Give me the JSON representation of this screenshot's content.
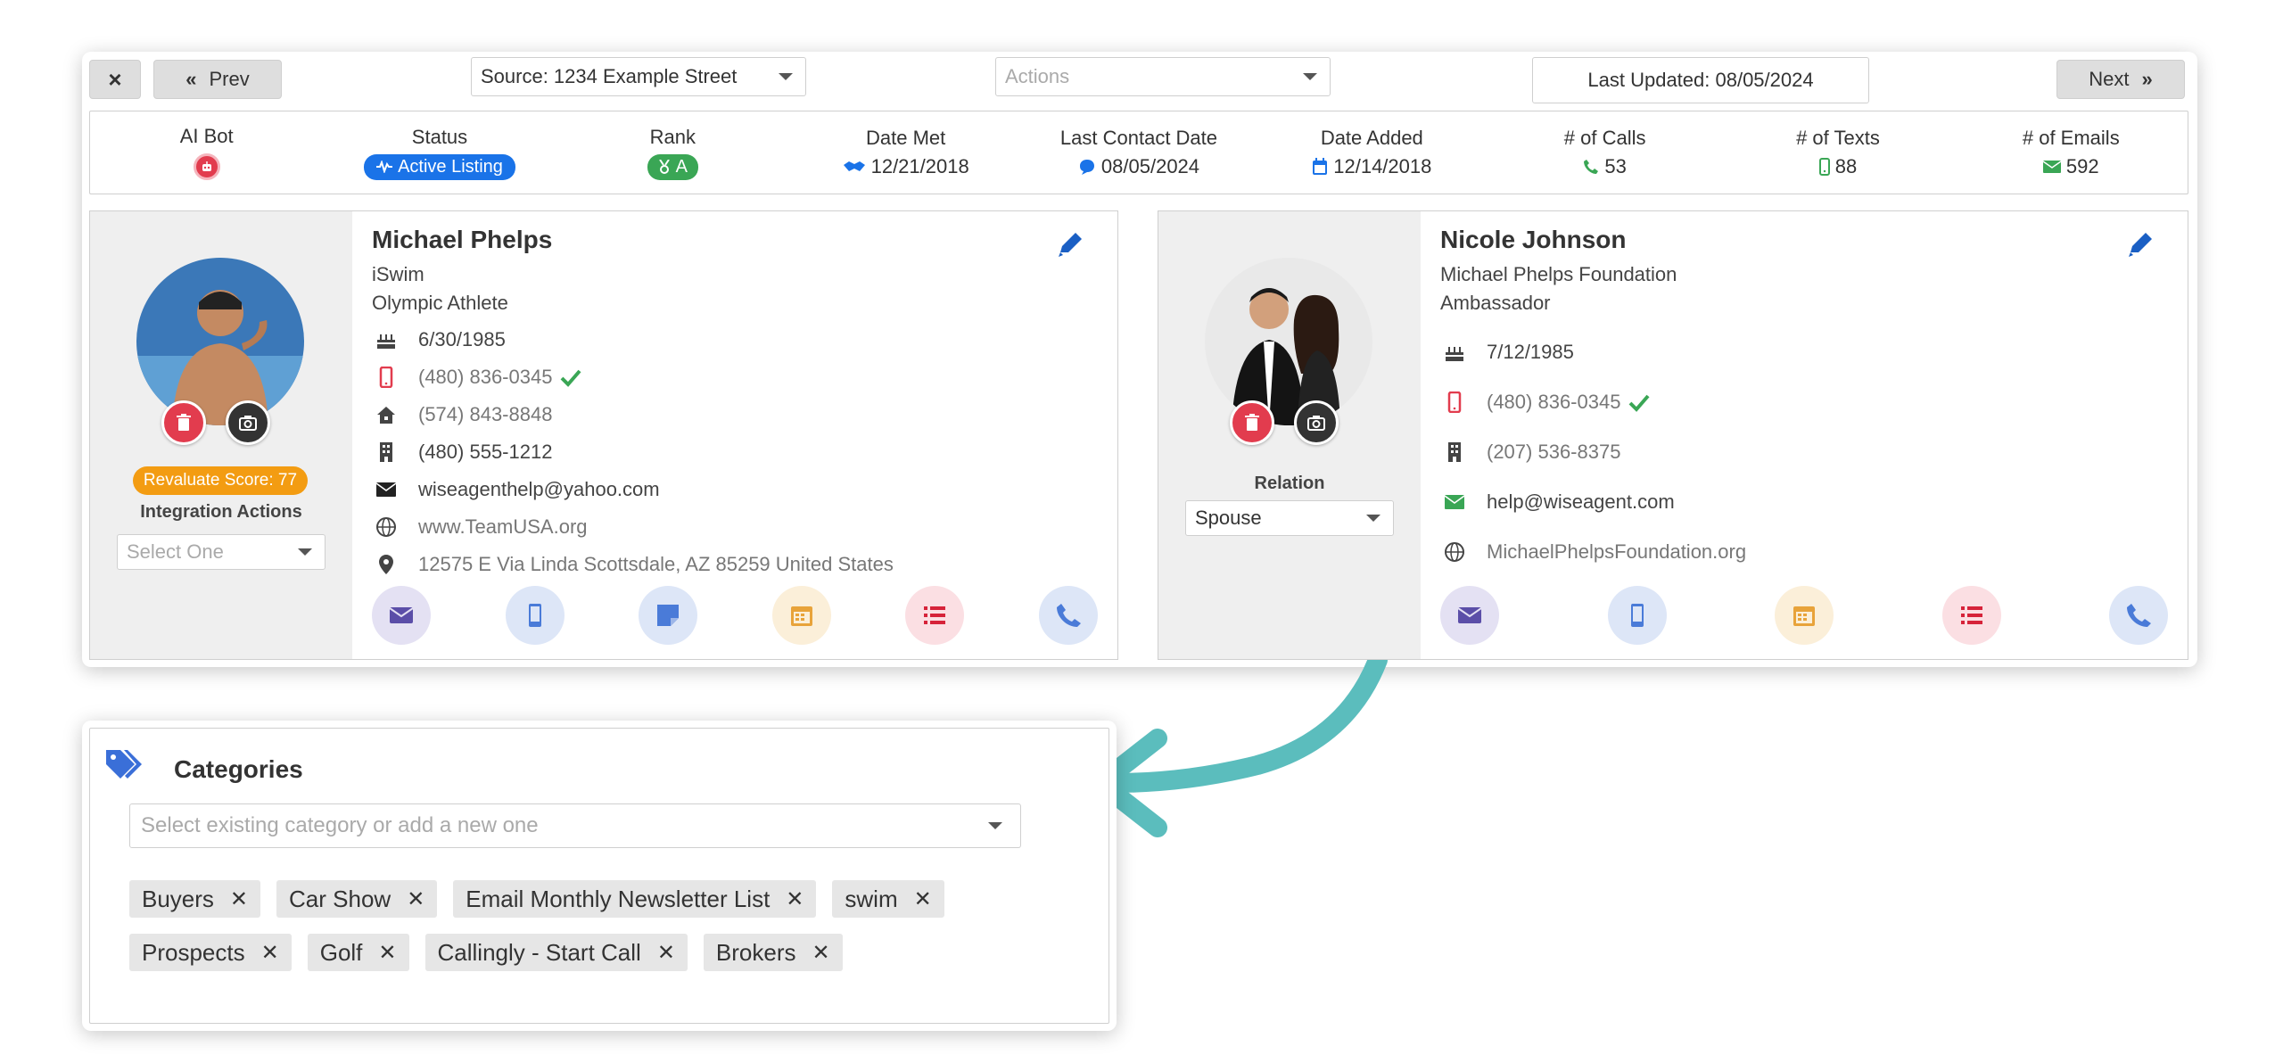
{
  "toolbar": {
    "close_label": "×",
    "prev_label": "Prev",
    "next_label": "Next",
    "source_value": "Source: 1234 Example Street",
    "actions_placeholder": "Actions",
    "last_updated": "Last Updated: 08/05/2024"
  },
  "stats": {
    "ai_bot_label": "AI Bot",
    "status_label": "Status",
    "status_value": "Active Listing",
    "rank_label": "Rank",
    "rank_value": "A",
    "date_met_label": "Date Met",
    "date_met_value": "12/21/2018",
    "last_contact_label": "Last Contact Date",
    "last_contact_value": "08/05/2024",
    "date_added_label": "Date Added",
    "date_added_value": "12/14/2018",
    "calls_label": "# of Calls",
    "calls_value": "53",
    "texts_label": "# of Texts",
    "texts_value": "88",
    "emails_label": "# of Emails",
    "emails_value": "592"
  },
  "primary_contact": {
    "name": "Michael Phelps",
    "company": "iSwim",
    "title": "Olympic Athlete",
    "birthday": "6/30/1985",
    "mobile": "(480) 836-0345",
    "home": "(574) 843-8848",
    "office": "(480) 555-1212",
    "email": "wiseagenthelp@yahoo.com",
    "website": "www.TeamUSA.org",
    "address": "12575 E Via Linda Scottsdale, AZ 85259 United States",
    "score_badge": "Revaluate Score: 77",
    "integration_label": "Integration Actions",
    "integration_placeholder": "Select One"
  },
  "related_contact": {
    "name": "Nicole Johnson",
    "company": "Michael Phelps Foundation",
    "title": "Ambassador",
    "birthday": "7/12/1985",
    "mobile": "(480) 836-0345",
    "office": "(207) 536-8375",
    "email": "help@wiseagent.com",
    "website": "MichaelPhelpsFoundation.org",
    "relation_label": "Relation",
    "relation_value": "Spouse"
  },
  "categories": {
    "title": "Categories",
    "placeholder": "Select existing category or add a new one",
    "tags": [
      "Buyers",
      "Car Show",
      "Email Monthly Newsletter List",
      "swim",
      "Prospects",
      "Golf",
      "Callingly - Start Call",
      "Brokers"
    ]
  },
  "colors": {
    "accent_blue": "#1a73e8",
    "danger_red": "#e23c4e",
    "success_green": "#3aa655",
    "badge_orange": "#f39c12",
    "arrow_teal": "#5bbdbd"
  }
}
